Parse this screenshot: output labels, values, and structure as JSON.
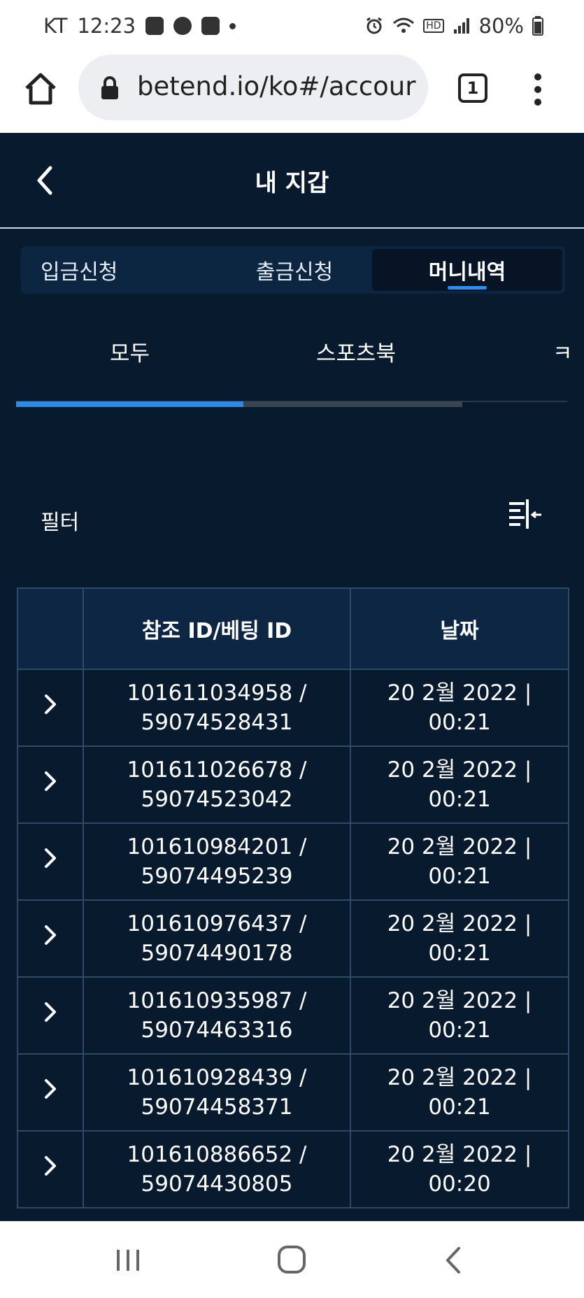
{
  "status_bar": {
    "carrier": "KT",
    "time": "12:23",
    "battery": "80%",
    "hd_label": "HD"
  },
  "browser": {
    "url": "betend.io/ko#/accour",
    "tab_count": "1"
  },
  "app": {
    "title": "내 지갑",
    "segments": [
      {
        "label": "입금신청",
        "active": false
      },
      {
        "label": "출금신청",
        "active": false
      },
      {
        "label": "머니내역",
        "active": true
      }
    ],
    "subtabs": [
      {
        "label": "모두",
        "active": true
      },
      {
        "label": "스포츠북",
        "active": false
      },
      {
        "label": "ㅋ",
        "active": false
      }
    ],
    "filter_label": "필터",
    "table": {
      "headers": [
        "",
        "참조 ID/베팅 ID",
        "날짜"
      ],
      "rows": [
        {
          "ref": "101611034958 /",
          "bet": "59074528431",
          "date": "20 2월 2022 |",
          "time": "00:21"
        },
        {
          "ref": "101611026678 /",
          "bet": "59074523042",
          "date": "20 2월 2022 |",
          "time": "00:21"
        },
        {
          "ref": "101610984201 /",
          "bet": "59074495239",
          "date": "20 2월 2022 |",
          "time": "00:21"
        },
        {
          "ref": "101610976437 /",
          "bet": "59074490178",
          "date": "20 2월 2022 |",
          "time": "00:21"
        },
        {
          "ref": "101610935987 /",
          "bet": "59074463316",
          "date": "20 2월 2022 |",
          "time": "00:21"
        },
        {
          "ref": "101610928439 /",
          "bet": "59074458371",
          "date": "20 2월 2022 |",
          "time": "00:21"
        },
        {
          "ref": "101610886652 /",
          "bet": "59074430805",
          "date": "20 2월 2022 |",
          "time": "00:20"
        }
      ]
    }
  },
  "colors": {
    "app_background": "#081a2e",
    "header_cell": "#0d2644",
    "accent_blue": "#2e8ae6",
    "grid_line": "#2d4a66"
  },
  "icons": [
    "home-icon",
    "lock-icon",
    "more-vert-icon",
    "back-chevron-icon",
    "filter-icon",
    "chevron-right-icon",
    "recents-icon",
    "home-nav-icon",
    "back-nav-icon",
    "alarm-icon",
    "wifi-icon",
    "signal-icon",
    "battery-icon"
  ]
}
